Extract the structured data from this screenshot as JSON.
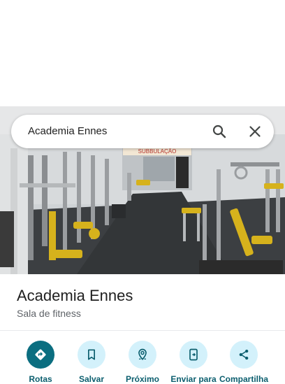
{
  "search": {
    "query": "Academia Ennes"
  },
  "place": {
    "name": "Academia Ennes",
    "category": "Sala de fitness"
  },
  "actions": [
    {
      "label": "Rotas",
      "icon": "directions-icon"
    },
    {
      "label": "Salvar",
      "icon": "bookmark-icon"
    },
    {
      "label": "Próximo",
      "icon": "nearby-icon"
    },
    {
      "label": "Enviar para",
      "icon": "send-to-phone-icon"
    },
    {
      "label": "Compartilha",
      "icon": "share-icon"
    }
  ],
  "photo": {
    "banner_text": "SUBBULAÇÃO"
  },
  "colors": {
    "primary": "#0b6e80",
    "chip": "#d3f1fb",
    "label": "#0b5e6e"
  }
}
